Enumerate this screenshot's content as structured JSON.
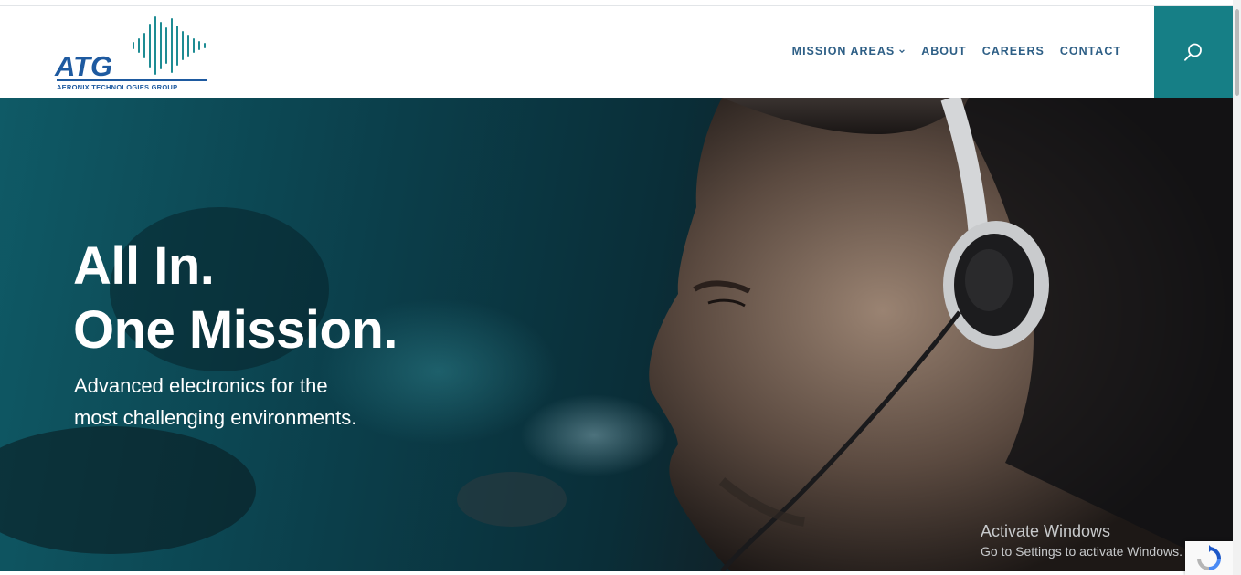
{
  "header": {
    "logo": {
      "letters": "ATG",
      "tagline": "AERONIX TECHNOLOGIES GROUP"
    },
    "nav": [
      {
        "label": "MISSION AREAS",
        "has_dropdown": true
      },
      {
        "label": "ABOUT"
      },
      {
        "label": "CAREERS"
      },
      {
        "label": "CONTACT"
      }
    ],
    "search": {
      "icon": "search-icon"
    }
  },
  "hero": {
    "title_line1": "All In.",
    "title_line2": "One Mission.",
    "subtitle_line1": "Advanced electronics for the",
    "subtitle_line2": "most challenging environments."
  },
  "overlay": {
    "activate_title": "Activate Windows",
    "activate_sub": "Go to Settings to activate Windows.",
    "recaptcha_icon": "recaptcha-icon"
  },
  "colors": {
    "brand_blue": "#1e5aa0",
    "brand_teal": "#167f86",
    "nav_text": "#2e5f86"
  }
}
